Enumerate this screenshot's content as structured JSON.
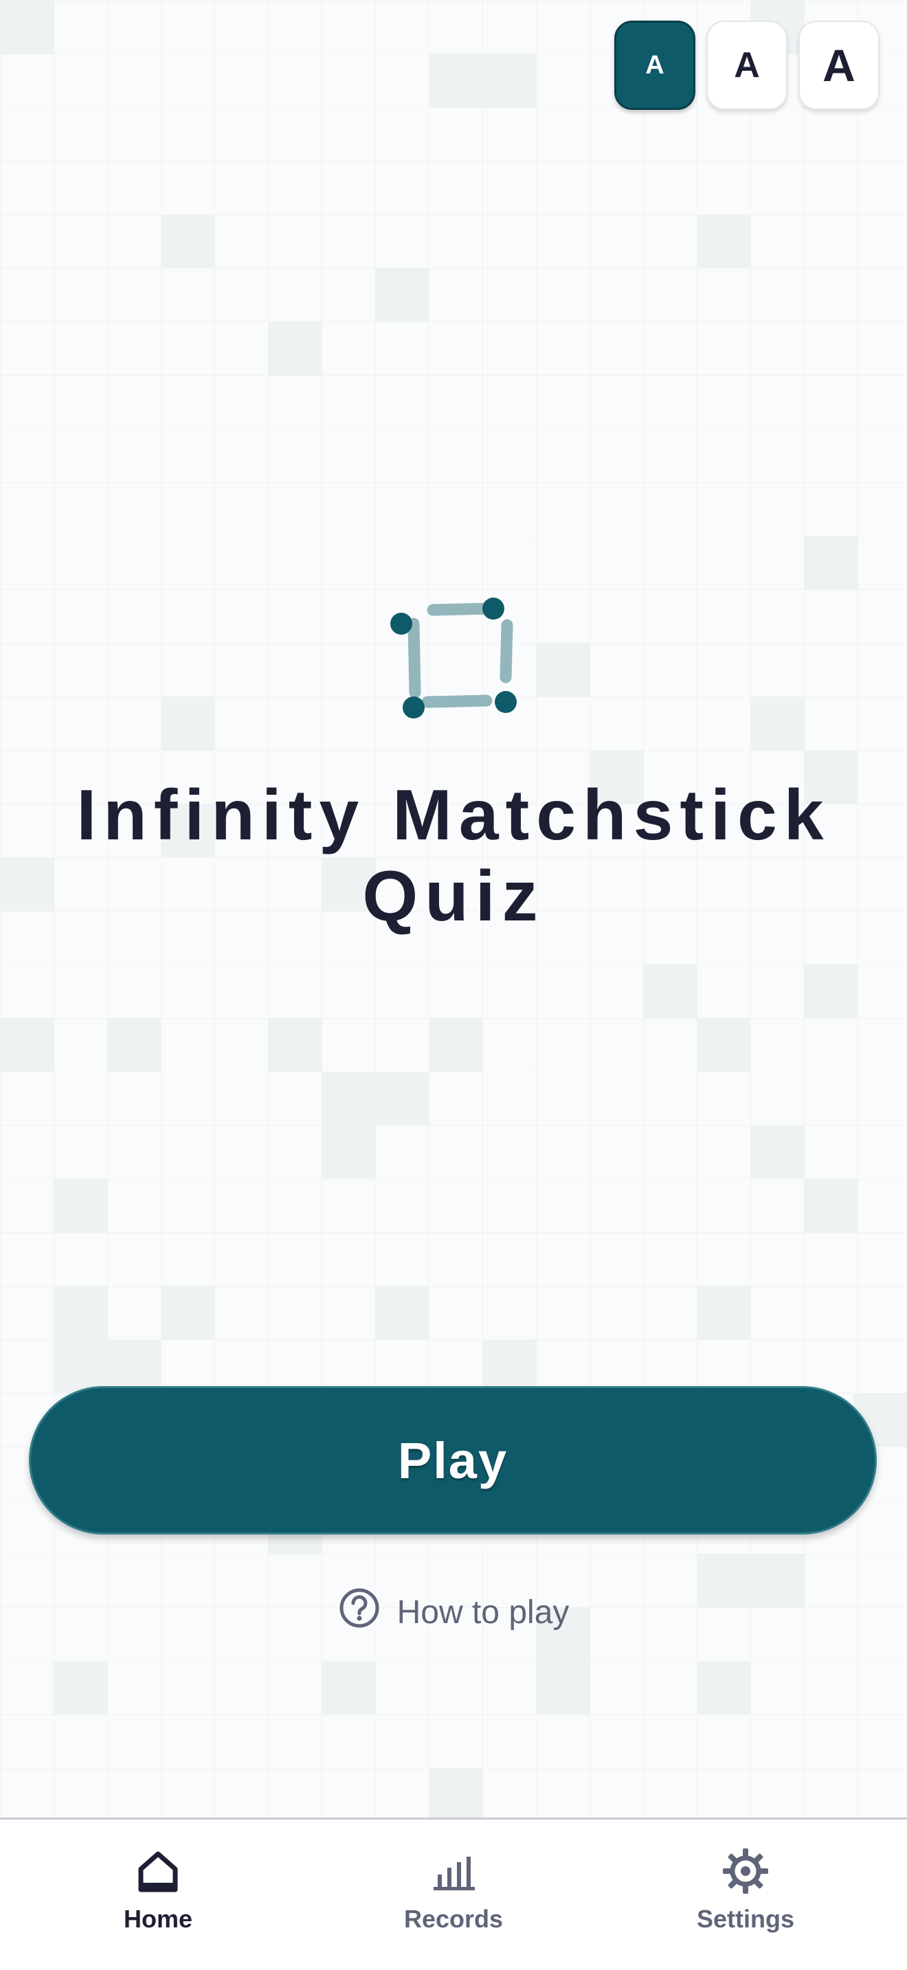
{
  "font_size_options": [
    {
      "label": "A",
      "size": "small",
      "selected": true
    },
    {
      "label": "A",
      "size": "medium",
      "selected": false
    },
    {
      "label": "A",
      "size": "large",
      "selected": false
    }
  ],
  "logo_icon": "matchstick-square-icon",
  "title": {
    "line1": "Infinity Matchstick",
    "line2": "Quiz"
  },
  "play_label": "Play",
  "how_to_play": {
    "label": "How to play",
    "icon": "help-circle-icon"
  },
  "bottom_nav": [
    {
      "label": "Home",
      "icon": "home-icon",
      "active": true
    },
    {
      "label": "Records",
      "icon": "bar-chart-icon",
      "active": false
    },
    {
      "label": "Settings",
      "icon": "gear-icon",
      "active": false
    }
  ],
  "colors": {
    "primary": "#0f5a68",
    "text_dark": "#1e1f33",
    "text_muted": "#5f6478",
    "matchstick": "#93b5bc",
    "tile": "#eef2f3"
  }
}
